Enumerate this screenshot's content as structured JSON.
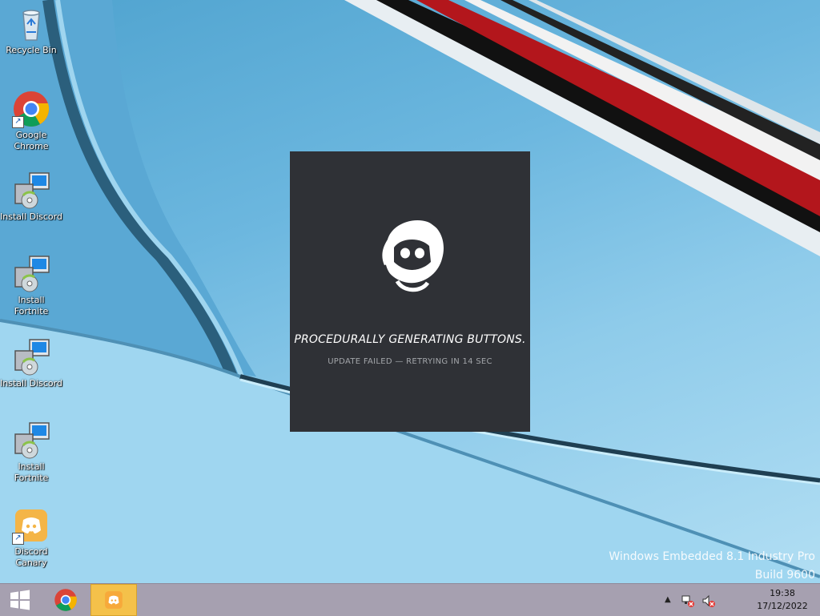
{
  "desktop": {
    "icons": [
      {
        "label": "Recycle Bin",
        "icon": "recycle-bin-icon"
      },
      {
        "label": "Google Chrome",
        "icon": "chrome-icon"
      },
      {
        "label": "Install Discord",
        "icon": "installer-icon"
      },
      {
        "label": "Install Fortnite",
        "icon": "installer-icon"
      },
      {
        "label": "Install Discord",
        "icon": "installer-icon"
      },
      {
        "label": "Install Fortnite",
        "icon": "installer-icon"
      },
      {
        "label": "Discord Canary",
        "icon": "discord-icon"
      }
    ],
    "watermark": {
      "line1": "Windows Embedded 8.1 Industry Pro",
      "line2": "Build 9600"
    }
  },
  "splash": {
    "title": "PROCEDURALLY GENERATING BUTTONS.",
    "status": "UPDATE FAILED — RETRYING IN 14 SEC"
  },
  "taskbar": {
    "time": "19:38",
    "date": "17/12/2022",
    "tray_icons": [
      "chevron-up-icon",
      "network-error-icon",
      "volume-muted-icon"
    ]
  },
  "colors": {
    "splash_bg": "#2f3136",
    "taskbar_bg": "#a6a0b0",
    "discord_active": "#f4c14a",
    "discord_blurple": "#5865f2"
  }
}
